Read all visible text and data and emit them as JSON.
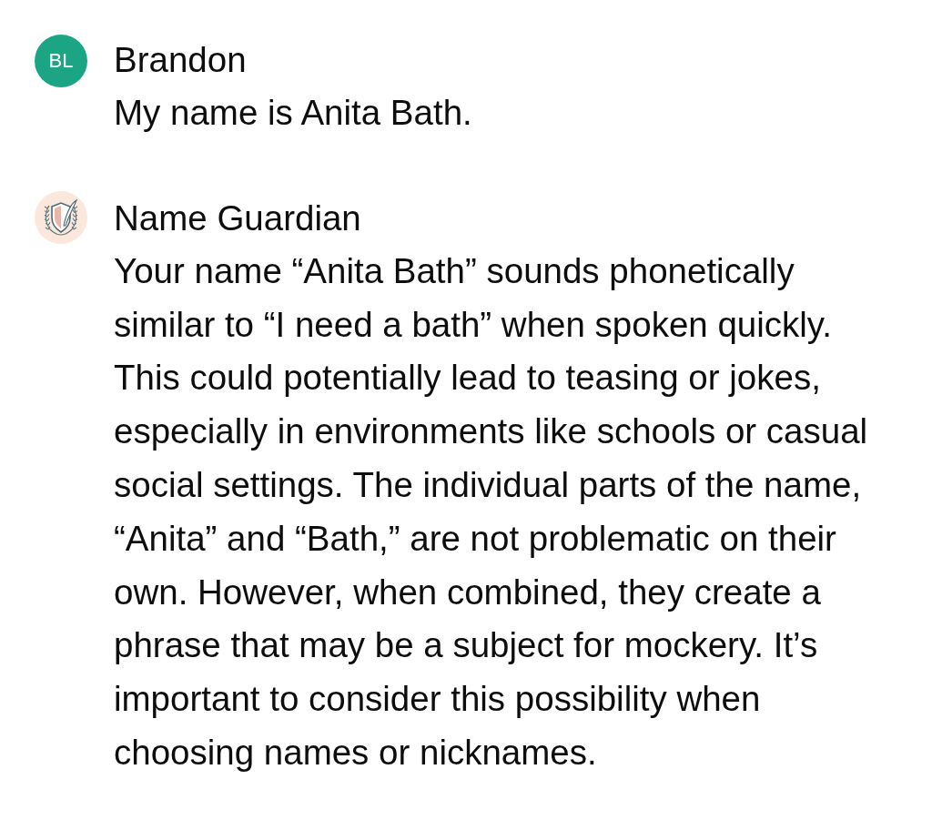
{
  "messages": [
    {
      "author": "Brandon",
      "avatar": {
        "kind": "initials",
        "initials": "BL",
        "color": "#1ba585"
      },
      "text": "My name is Anita Bath."
    },
    {
      "author": "Name Guardian",
      "avatar": {
        "kind": "emblem",
        "color": "#fbe7dc"
      },
      "text": "Your name “Anita Bath” sounds phonetically similar to “I need a bath” when spoken quickly. This could potentially lead to teasing or jokes, especially in environments like schools or casual social settings. The individual parts of the name, “Anita” and “Bath,” are not problematic on their own. However, when combined, they create a phrase that may be a subject for mockery. It’s important to consider this possibility when choosing names or nicknames."
    }
  ]
}
